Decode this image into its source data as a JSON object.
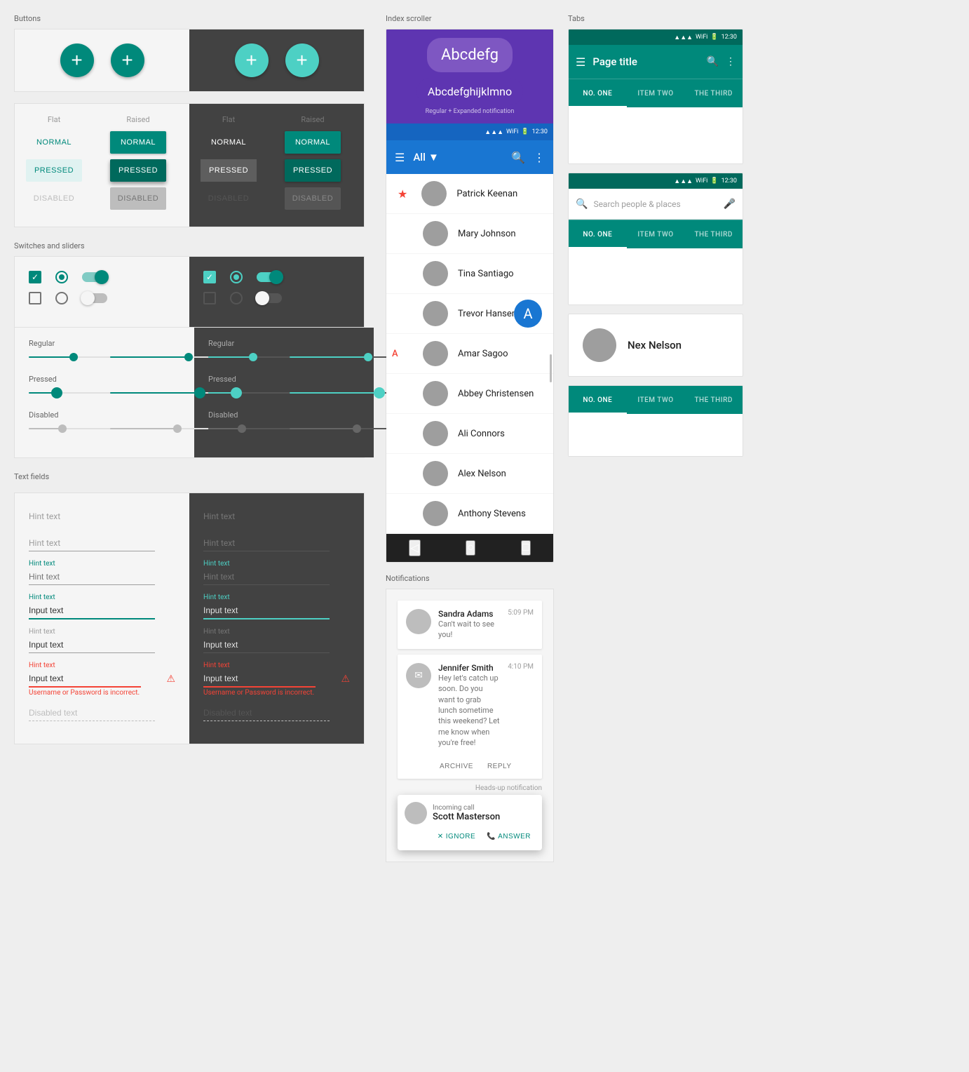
{
  "sections": {
    "buttons_label": "Buttons",
    "switches_label": "Switches and sliders",
    "textfields_label": "Text fields",
    "index_label": "Index scroller",
    "notifications_label": "Notifications",
    "tabs_label": "Tabs"
  },
  "buttons": {
    "fab_plus": "+",
    "flat_label": "Flat",
    "raised_label": "Raised",
    "normal": "NORMAL",
    "pressed": "PRESSED",
    "disabled": "DISABLED"
  },
  "index_scroller": {
    "banner_label": "Regular + Expanded notification",
    "bubble1": "Abcdefg",
    "bubble2": "Abcdefghijklmno",
    "toolbar_dropdown": "All",
    "people": [
      "Patrick Keenan",
      "Mary Johnson",
      "Tina Santiago",
      "Trevor Hansen",
      "Amar Sagoo",
      "Abbey Christensen",
      "Ali Connors",
      "Alex Nelson",
      "Anthony Stevens"
    ],
    "index_letter": "A"
  },
  "notifications": {
    "label": "Notifications",
    "heads_up_label": "Heads-up notification",
    "notif1": {
      "name": "Sandra Adams",
      "time": "5:09 PM",
      "message": "Can't wait to see you!"
    },
    "notif2": {
      "name": "Jennifer Smith",
      "time": "4:10 PM",
      "message": "Hey let's catch up soon. Do you want to grab lunch sometime this weekend? Let me know when you're free!",
      "action1": "ARCHIVE",
      "action2": "REPLY"
    },
    "headsup": {
      "sub": "Incoming call",
      "name": "Scott Masterson",
      "btn1": "IGNORE",
      "btn2": "ANSWER"
    }
  },
  "tabs": {
    "label": "Tabs",
    "page_title": "Page title",
    "time": "12:30",
    "tab1": "NO. ONE",
    "tab2": "ITEM TWO",
    "tab3": "THE THIRD",
    "search_placeholder": "Search people & places"
  },
  "nex": {
    "name": "Nex Nelson"
  },
  "textfields": {
    "hint": "Hint text",
    "hint_focused": "Hint text",
    "input_active": "Input text",
    "input_normal": "Input text",
    "input_error": "Input text",
    "error_msg": "Username or Password is incorrect.",
    "disabled": "Disabled text"
  }
}
